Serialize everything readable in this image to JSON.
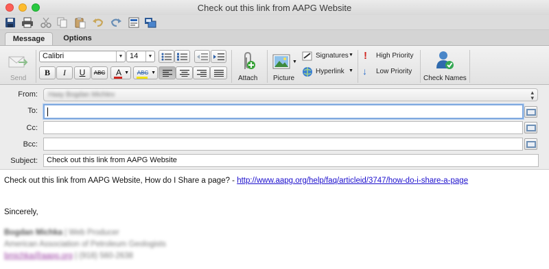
{
  "window": {
    "title": "Check out this link from AAPG Website"
  },
  "quick_toolbar": {
    "icons": [
      "save-icon",
      "print-icon",
      "cut-icon",
      "copy-icon",
      "paste-icon",
      "undo-icon",
      "redo-icon",
      "form-icon",
      "share-icon"
    ]
  },
  "tabs": [
    {
      "label": "Message",
      "active": true
    },
    {
      "label": "Options",
      "active": false
    }
  ],
  "ribbon": {
    "send_label": "Send",
    "font_name": "Calibri",
    "font_size": "14",
    "attach_label": "Attach",
    "picture_label": "Picture",
    "signatures_label": "Signatures",
    "hyperlink_label": "Hyperlink",
    "high_priority_label": "High Priority",
    "low_priority_label": "Low Priority",
    "check_names_label": "Check Names",
    "format_buttons": [
      "B",
      "I",
      "U",
      "ABC",
      "A",
      "ABC"
    ]
  },
  "header": {
    "from_label": "From:",
    "from_value": "Haay Bogdan Michlev",
    "to_label": "To:",
    "to_value": "",
    "cc_label": "Cc:",
    "cc_value": "",
    "bcc_label": "Bcc:",
    "bcc_value": "",
    "subject_label": "Subject:",
    "subject_value": "Check out this link from AAPG Website"
  },
  "body": {
    "line1_text": "Check out this link from AAPG Website, How do I Share a page? - ",
    "line1_link": "http://www.aapg.org/help/faq/articleid/3747/how-do-i-share-a-page",
    "closing": "Sincerely,",
    "sig_name": "Bogdan Michka",
    "sig_sep": " | ",
    "sig_role": "Web Producer",
    "sig_org": "American Association of Petroleum Geologists",
    "sig_email": "bmichka@aapg.org",
    "sig_phone": " | (918) 560-2638"
  },
  "colors": {
    "link": "#1a0dcc",
    "focus_border": "#7fa9df",
    "high_priority": "#d0241d",
    "low_priority": "#2d6ec9"
  }
}
